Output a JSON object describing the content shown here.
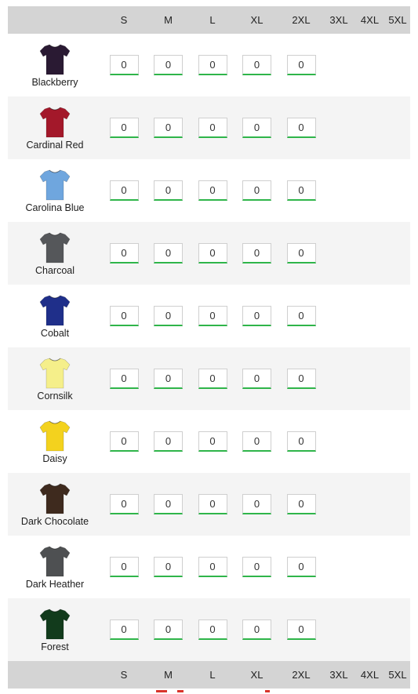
{
  "sizes": [
    "S",
    "M",
    "L",
    "XL",
    "2XL",
    "3XL",
    "4XL",
    "5XL"
  ],
  "available_sizes": [
    "S",
    "M",
    "L",
    "XL",
    "2XL"
  ],
  "rows": [
    {
      "name": "Blackberry",
      "color": "#2a1a33",
      "quantities": [
        "0",
        "0",
        "0",
        "0",
        "0"
      ]
    },
    {
      "name": "Cardinal Red",
      "color": "#a3182a",
      "quantities": [
        "0",
        "0",
        "0",
        "0",
        "0"
      ]
    },
    {
      "name": "Carolina Blue",
      "color": "#6fa6de",
      "quantities": [
        "0",
        "0",
        "0",
        "0",
        "0"
      ]
    },
    {
      "name": "Charcoal",
      "color": "#55575a",
      "quantities": [
        "0",
        "0",
        "0",
        "0",
        "0"
      ]
    },
    {
      "name": "Cobalt",
      "color": "#1f2f8a",
      "quantities": [
        "0",
        "0",
        "0",
        "0",
        "0"
      ]
    },
    {
      "name": "Cornsilk",
      "color": "#f5ef8a",
      "quantities": [
        "0",
        "0",
        "0",
        "0",
        "0"
      ]
    },
    {
      "name": "Daisy",
      "color": "#f3d21e",
      "quantities": [
        "0",
        "0",
        "0",
        "0",
        "0"
      ]
    },
    {
      "name": "Dark Chocolate",
      "color": "#3e2a1e",
      "quantities": [
        "0",
        "0",
        "0",
        "0",
        "0"
      ]
    },
    {
      "name": "Dark Heather",
      "color": "#4e5052",
      "quantities": [
        "0",
        "0",
        "0",
        "0",
        "0"
      ]
    },
    {
      "name": "Forest",
      "color": "#123b1c",
      "quantities": [
        "0",
        "0",
        "0",
        "0",
        "0"
      ]
    }
  ],
  "accent_color": "#2fb54a",
  "shirt_icon": "t-shirt-icon"
}
